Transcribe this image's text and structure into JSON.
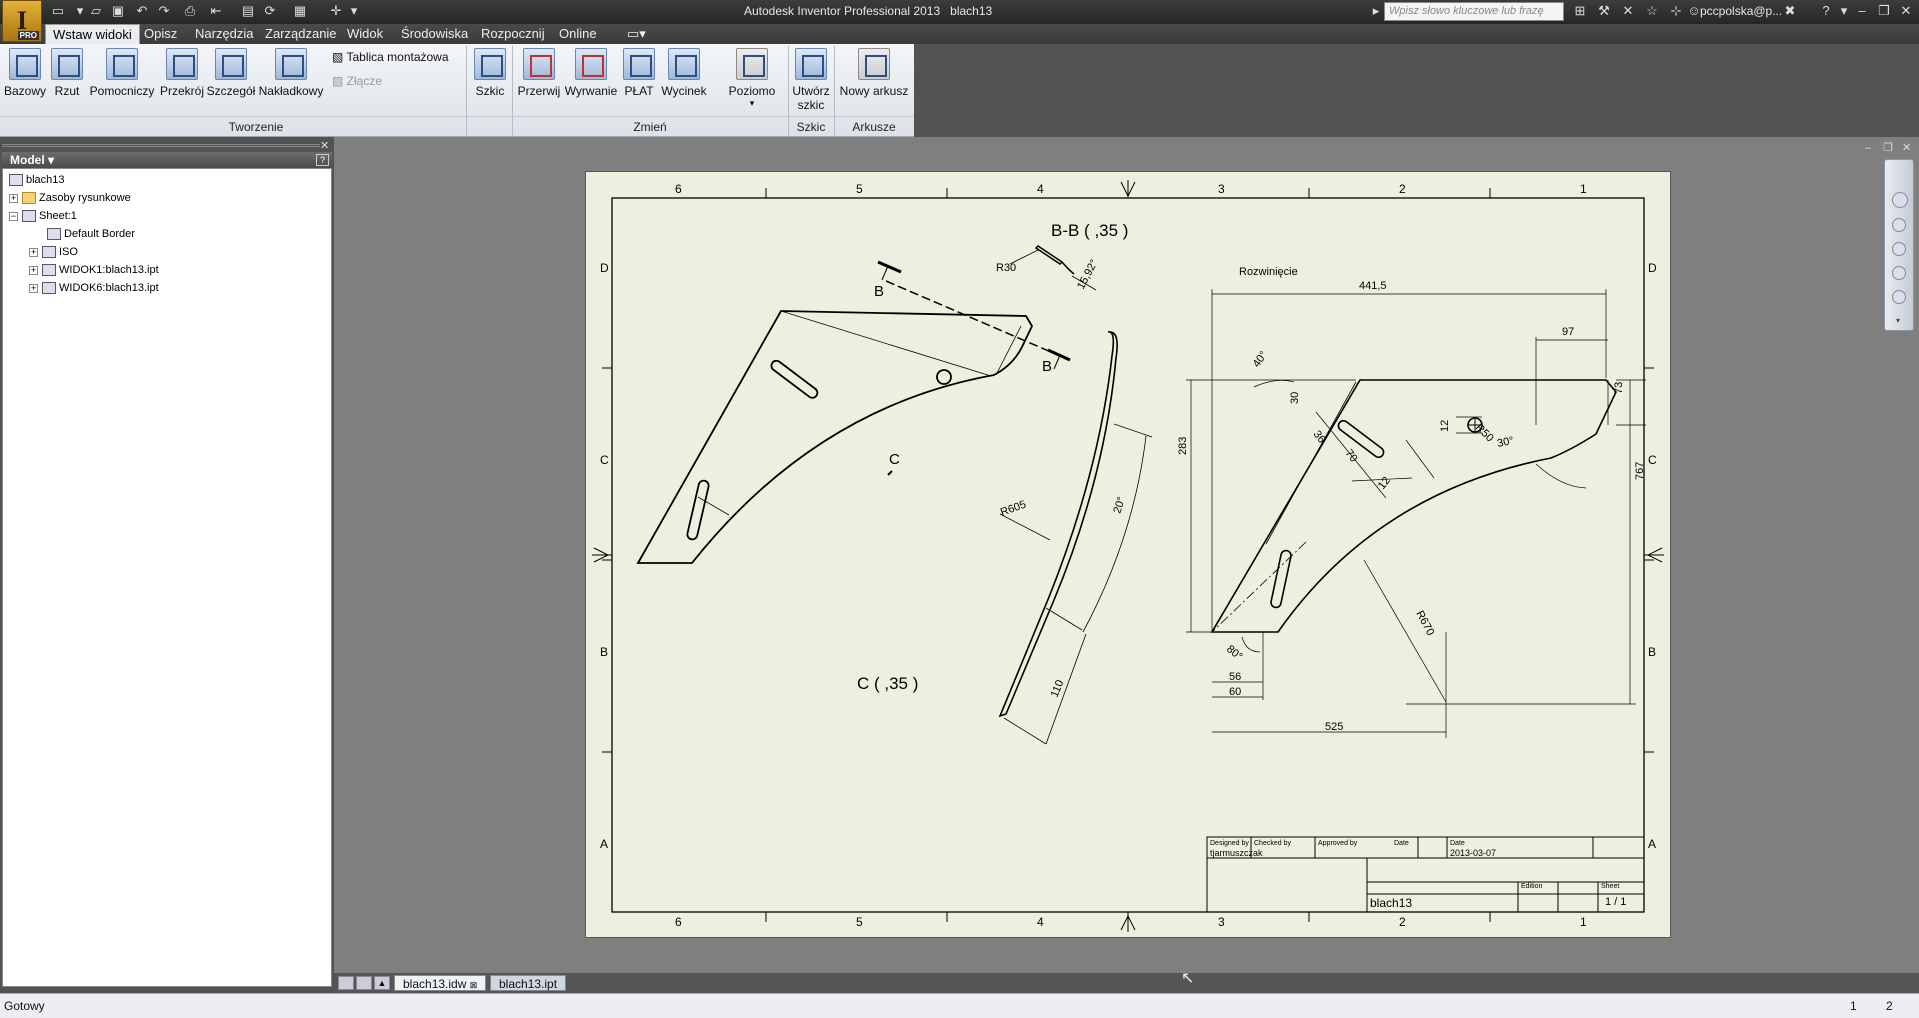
{
  "app": {
    "title": "Autodesk Inventor Professional 2013",
    "document": "blach13",
    "logo_badge": "PRO",
    "search_placeholder": "Wpisz słowo kluczowe lub frazę",
    "user": "pccpolska@p..."
  },
  "menu": {
    "tabs": [
      "Wstaw widoki",
      "Opisz",
      "Narzędzia",
      "Zarządzanie",
      "Widok",
      "Środowiska",
      "Rozpocznij",
      "Online"
    ],
    "active": "Wstaw widoki"
  },
  "ribbon": {
    "groups": {
      "create": "Tworzenie",
      "modify": "Zmień",
      "sketch": "Szkic",
      "sheets": "Arkusze"
    },
    "create_buttons": [
      "Bazowy",
      "Rzut",
      "Pomocniczy",
      "Przekrój",
      "Szczegół",
      "Nakładkowy"
    ],
    "small_buttons": [
      "Tablica montażowa",
      "Złącze"
    ],
    "szkic_button": "Szkic",
    "modify_buttons": [
      "Przerwij",
      "Wyrwanie",
      "PŁAT",
      "Wycinek"
    ],
    "poziomo": "Poziomo",
    "sketch_button": [
      "Utwórz",
      "szkic"
    ],
    "sheet_button": "Nowy arkusz"
  },
  "browser": {
    "header": "Model",
    "nodes": [
      "blach13",
      "Zasoby rysunkowe",
      "Sheet:1",
      "Default Border",
      "ISO",
      "WIDOK1:blach13.ipt",
      "WIDOK6:blach13.ipt"
    ]
  },
  "drawing": {
    "zone_cols_top": [
      "6",
      "5",
      "4",
      "3",
      "2",
      "1"
    ],
    "zone_rows": [
      "D",
      "C",
      "B",
      "A"
    ],
    "section_title": "B-B ( ,35 )",
    "section_marker": "B",
    "detail_label": "C",
    "view_c_title": "C ( ,35 )",
    "flat_title": "Rozwinięcie",
    "dims": {
      "r30": "R30",
      "ang_1592": "15,92°",
      "d4415": "441,5",
      "d97": "97",
      "a40": "40°",
      "d30": "30",
      "d36": "36",
      "d70": "70",
      "d12a": "12",
      "d12b": "12",
      "r50": "R50",
      "d73": "73",
      "a30": "30°",
      "d283": "283",
      "d767": "767",
      "r670": "R670",
      "a80": "80°",
      "d56": "56",
      "d60": "60",
      "d525": "525",
      "r605": "R605",
      "a20": "20°",
      "d110": "110"
    },
    "title_block": {
      "designed_by_label": "Designed by",
      "checked_by_label": "Checked by",
      "approved_by_label": "Approved by",
      "date_label": "Date",
      "date_label2": "Date",
      "designer": "tjarmuszczak",
      "date": "2013-03-07",
      "doc_name": "blach13",
      "edition_label": "Edition",
      "sheet_label": "Sheet",
      "sheet": "1 / 1"
    }
  },
  "doc_tabs": [
    "blach13.idw",
    "blach13.ipt"
  ],
  "status": {
    "text": "Gotowy",
    "num1": "1",
    "num2": "2"
  }
}
